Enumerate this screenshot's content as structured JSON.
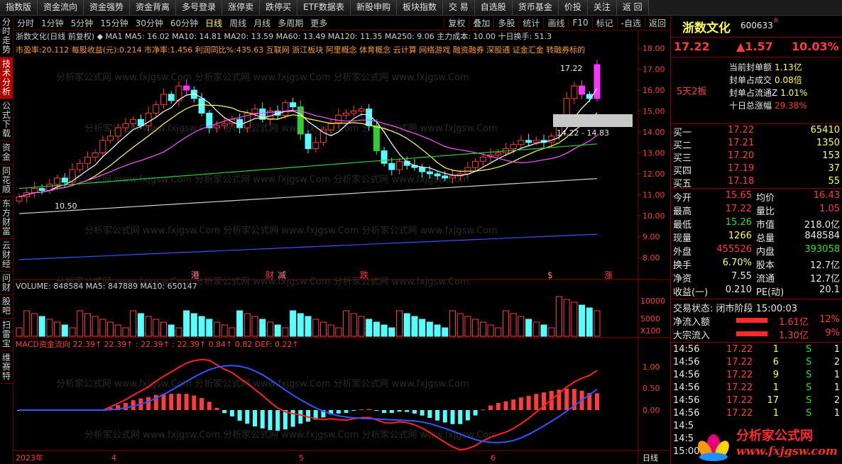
{
  "toolbar": [
    "指数版",
    "资金流向",
    "资金强势",
    "资金背离",
    "多号登录",
    "涨停卖",
    "跌停买",
    "ETF数据表",
    "新股申购",
    "板块指数",
    "交 易",
    "自选股",
    "货币基金",
    "价投",
    "关注",
    "返 回"
  ],
  "leftnav": [
    {
      "label": "分时走势",
      "active": false
    },
    {
      "label": "技术分析",
      "active": true
    },
    {
      "label": "公式下载",
      "active": false
    },
    {
      "label": "资金",
      "active": false
    },
    {
      "label": "同花顺",
      "active": false
    },
    {
      "label": "东方财富",
      "active": false
    },
    {
      "label": "云财经",
      "active": false
    },
    {
      "label": "问财",
      "active": false
    },
    {
      "label": "股吧",
      "active": false
    },
    {
      "label": "扫雷宝",
      "active": false
    },
    {
      "label": "维赛特",
      "active": false
    }
  ],
  "periods": [
    "分时",
    "1分钟",
    "5分钟",
    "15分钟",
    "30分钟",
    "60分钟",
    "日线",
    "周线",
    "月线",
    "多周期",
    "更多"
  ],
  "selected_period": "日线",
  "chart_tools": [
    "复权",
    "叠加",
    "多股",
    "统计",
    "画线",
    "F10",
    "标记",
    "-自选",
    "返回"
  ],
  "main": {
    "indicator_line": "浙数文化(日线 前复权) ◆ MA1 MA5: 16.02 MA10: 14.81 MA20: 13.59 MA60: 13.49 MA120: 11.35 MA250: 9.06 主力成本: 10.00 十日换手: 51.3",
    "info_line": "市盈率:20.112 每股收益(元):0.214 市净率:1.456 利润同比%:435.63 互联网 浙江板块 阿里概念 体育概念 云计算 网络游戏 融资融券 深股通 证金汇金 转融券标的",
    "y_ticks": [
      "18.00",
      "17.00",
      "16.00",
      "15.00",
      "14.00",
      "13.00",
      "12.00",
      "11.00",
      "10.00",
      "9.00",
      "8.00"
    ],
    "label_high": "17.22",
    "label_range": "14.22 - 14.83",
    "label_low": "10.50",
    "event_marks": [
      "港",
      "财",
      "减",
      "跌",
      "$",
      "涨"
    ]
  },
  "volume": {
    "title": "VOLUME: 848584  MA5: 847889  MA10: 650147",
    "y_ticks": [
      "10000",
      "5000",
      "X100"
    ]
  },
  "macd": {
    "title": "MACD资金流向 22.39↑ 22.39↑ : 22.39↑ : 22.39↑ 0.84↑ 0.82 DEF: 0.22↑",
    "y_ticks": [
      "1.00",
      "0.50",
      "0.00"
    ]
  },
  "xaxis": {
    "labels": [
      "2023年",
      "4",
      "5",
      "6"
    ],
    "right": "日线"
  },
  "quote": {
    "name": "浙数文化",
    "code": "600633",
    "price": "17.22",
    "change": "▲1.57",
    "pct": "10.03%",
    "streak": "5天2板",
    "seal_items": [
      {
        "label": "当前封单额",
        "value": "1.13亿"
      },
      {
        "label": "封单占成交",
        "value": "0.08倍"
      },
      {
        "label": "封单占流通Z",
        "value": "1.01%"
      },
      {
        "label": "十日总涨幅",
        "value": "29.38%"
      }
    ],
    "bids": [
      {
        "label": "买一",
        "price": "17.22",
        "vol": "65410"
      },
      {
        "label": "买二",
        "price": "17.21",
        "vol": "1350"
      },
      {
        "label": "买三",
        "price": "17.20",
        "vol": "153"
      },
      {
        "label": "买四",
        "price": "17.19",
        "vol": "37"
      },
      {
        "label": "买五",
        "price": "17.18",
        "vol": "55"
      }
    ],
    "stats": [
      {
        "l1": "今开",
        "v1": "15.65",
        "l2": "均价",
        "v2": "16.43"
      },
      {
        "l1": "最高",
        "v1": "17.22",
        "l2": "量比",
        "v2": "1.05"
      },
      {
        "l1": "最低",
        "v1": "15.26",
        "l2": "市值",
        "v2": "218.0亿"
      },
      {
        "l1": "现量",
        "v1": "1266",
        "l2": "总量",
        "v2": "848584"
      },
      {
        "l1": "外盘",
        "v1": "455526",
        "l2": "内盘",
        "v2": "393058"
      },
      {
        "l1": "换手",
        "v1": "6.70%",
        "l2": "股本",
        "v2": "12.7亿"
      },
      {
        "l1": "净资",
        "v1": "7.55",
        "l2": "流通",
        "v2": "12.7亿"
      },
      {
        "l1": "收益(一)",
        "v1": "0.210",
        "l2": "PE(动)",
        "v2": "20.1"
      }
    ],
    "trade_status": "交易状态: 闭市阶段 15:00:03",
    "flows": [
      {
        "label": "净流入额",
        "value": "1.61亿",
        "pct": "12%"
      },
      {
        "label": "大宗流入",
        "value": "1.30亿",
        "pct": "9%"
      }
    ],
    "ticks": [
      {
        "t": "14:56",
        "p": "17.22",
        "v": "1",
        "s": "S",
        "n": "1"
      },
      {
        "t": "14:56",
        "p": "17.22",
        "v": "6",
        "s": "S",
        "n": "2"
      },
      {
        "t": "14:56",
        "p": "17.22",
        "v": "9",
        "s": "S",
        "n": "1"
      },
      {
        "t": "14:56",
        "p": "17.22",
        "v": "1",
        "s": "S",
        "n": "1"
      },
      {
        "t": "14:56",
        "p": "17.22",
        "v": "17",
        "s": "S",
        "n": "2"
      },
      {
        "t": "14:56",
        "p": "17.22",
        "v": "1",
        "s": "S",
        "n": "1"
      },
      {
        "t": "14:5",
        "p": "",
        "v": "",
        "s": "",
        "n": ""
      },
      {
        "t": "14:5",
        "p": "",
        "v": "",
        "s": "",
        "n": ""
      },
      {
        "t": "15:00",
        "p": "",
        "v": "",
        "s": "",
        "n": ""
      }
    ]
  },
  "watermark": {
    "brand": "分析家公式网",
    "url": "www.fxjgsw.com"
  },
  "colors": {
    "up": "#ff3b3b",
    "down": "#55ffff",
    "limit": "#ff33ff",
    "ma5": "#ffffff",
    "ma10": "#ffff54",
    "ma20": "#ff55ff",
    "ma60": "#33cc33",
    "ma120": "#d0d0d0",
    "ma250": "#3355ff"
  }
}
